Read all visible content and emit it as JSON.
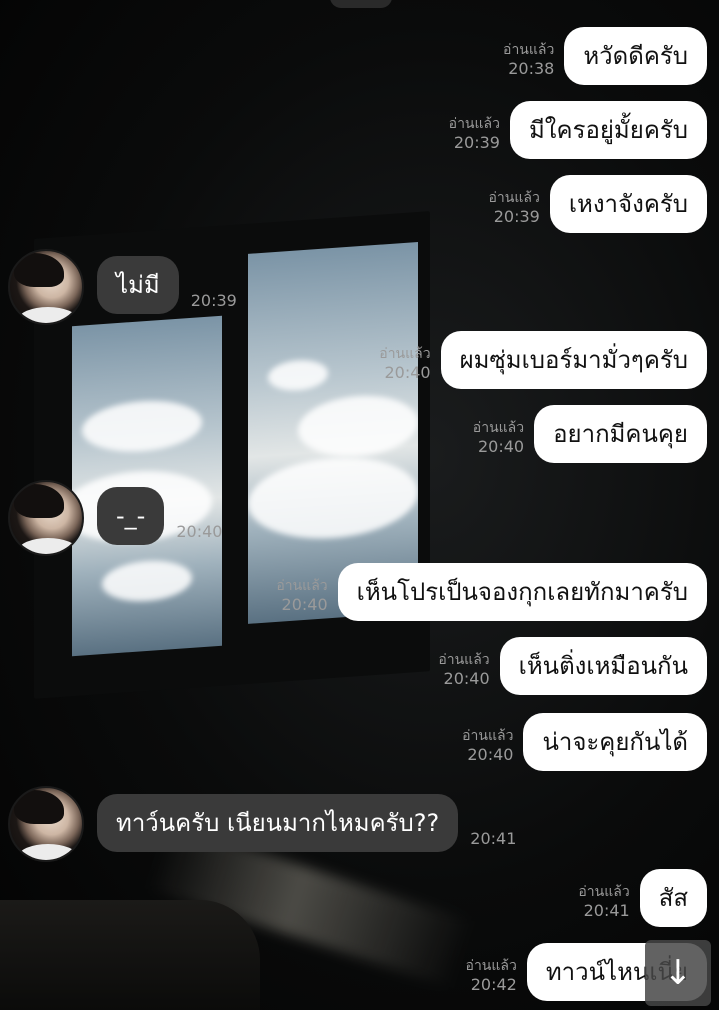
{
  "conversation": {
    "messages": [
      {
        "id": "m1",
        "direction": "out",
        "text": "หวัดดีครับ",
        "read": "อ่านแล้ว",
        "time": "20:38"
      },
      {
        "id": "m2",
        "direction": "out",
        "text": "มีใครอยู่มั้ยครับ",
        "read": "อ่านแล้ว",
        "time": "20:39"
      },
      {
        "id": "m3",
        "direction": "out",
        "text": "เหงาจังครับ",
        "read": "อ่านแล้ว",
        "time": "20:39"
      },
      {
        "id": "m4",
        "direction": "in",
        "text": "ไม่มี",
        "time": "20:39"
      },
      {
        "id": "m5",
        "direction": "out",
        "text": "ผมซุ่มเบอร์มามั่วๆครับ",
        "read": "อ่านแล้ว",
        "time": "20:40"
      },
      {
        "id": "m6",
        "direction": "out",
        "text": "อยากมีคนคุย",
        "read": "อ่านแล้ว",
        "time": "20:40"
      },
      {
        "id": "m7",
        "direction": "in",
        "text": "-_-",
        "time": "20:40"
      },
      {
        "id": "m8",
        "direction": "out",
        "text": "เห็นโปรเป็นจองกุกเลยทักมาครับ",
        "read": "อ่านแล้ว",
        "time": "20:40"
      },
      {
        "id": "m9",
        "direction": "out",
        "text": "เห็นติ่งเหมือนกัน",
        "read": "อ่านแล้ว",
        "time": "20:40"
      },
      {
        "id": "m10",
        "direction": "out",
        "text": "น่าจะคุยกันได้",
        "read": "อ่านแล้ว",
        "time": "20:40"
      },
      {
        "id": "m11",
        "direction": "in",
        "text": "ทาว์นครับ เนียนมากไหมครับ??",
        "time": "20:41"
      },
      {
        "id": "m12",
        "direction": "out",
        "text": "สัส",
        "read": "อ่านแล้ว",
        "time": "20:41"
      },
      {
        "id": "m13",
        "direction": "out",
        "text": "ทาวน์ไหนเนี่ย",
        "read": "อ่านแล้ว",
        "time": "20:42"
      }
    ]
  },
  "controls": {
    "scroll_down_icon": "arrow-down-icon",
    "scroll_down_glyph": "↓"
  },
  "colors": {
    "outgoing_bubble": "#ffffff",
    "incoming_bubble": "#3a3a3a",
    "meta_text": "#9a9a9a"
  }
}
